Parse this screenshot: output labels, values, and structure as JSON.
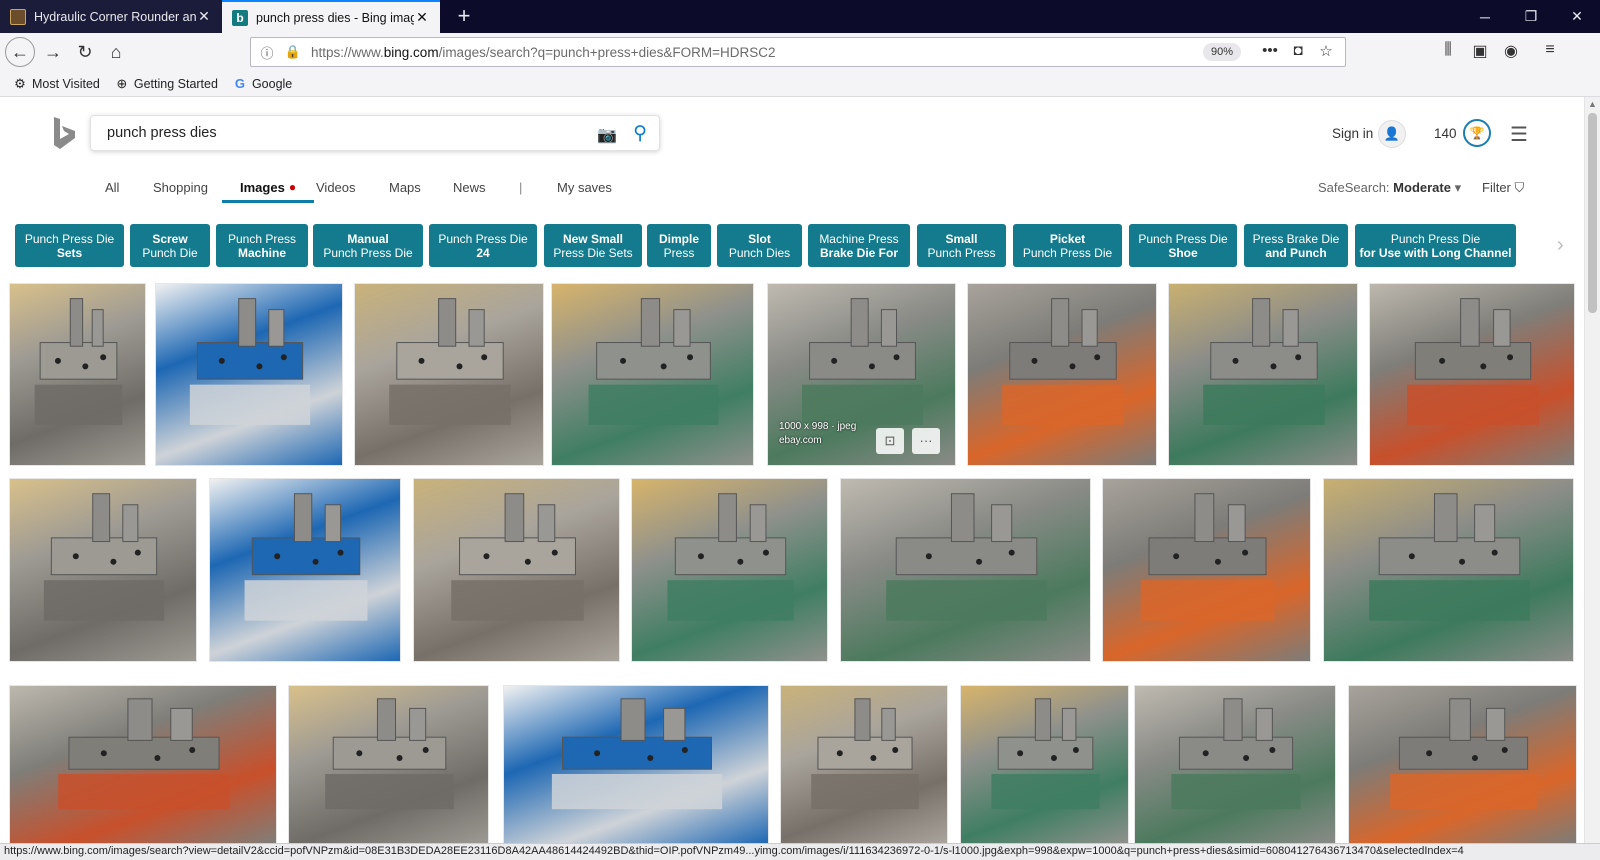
{
  "browser": {
    "tabs": [
      {
        "title": "Hydraulic Corner Rounder and",
        "active": false
      },
      {
        "title": "punch press dies - Bing images",
        "active": true
      }
    ],
    "url_prefix": "https://www.",
    "url_domain": "bing.com",
    "url_rest": "/images/search?q=punch+press+dies&FORM=HDRSC2",
    "zoom": "90%",
    "bookmarks": [
      "Most Visited",
      "Getting Started",
      "Google"
    ],
    "status_url": "https://www.bing.com/images/search?view=detailV2&ccid=pofVNPzm&id=08E31B3DEDA28EE23116D8A42AA48614424492BD&thid=OIP.pofVNPzm49...yimg.com/images/i/111634236972-0-1/s-l1000.jpg&exph=998&expw=1000&q=punch+press+dies&simid=608041276436713470&selectedIndex=4"
  },
  "search": {
    "query": "punch press dies"
  },
  "header": {
    "sign_in": "Sign in",
    "rewards_count": "140"
  },
  "scopes": {
    "all": "All",
    "shopping": "Shopping",
    "images": "Images",
    "videos": "Videos",
    "maps": "Maps",
    "news": "News",
    "sep": "|",
    "my_saves": "My saves",
    "safesearch_label": "SafeSearch:",
    "safesearch_value": "Moderate",
    "filter": "Filter"
  },
  "related": [
    {
      "line1": "Punch Press Die",
      "line2": "Sets",
      "bold_line": 2
    },
    {
      "line1": "Screw",
      "line2": "Punch Die",
      "bold_line": 1
    },
    {
      "line1": "Punch Press",
      "line2": "Machine",
      "bold_line": 2
    },
    {
      "line1": "Manual",
      "line2": "Punch Press Die",
      "bold_line": 1
    },
    {
      "line1": "Punch Press Die",
      "line2": "24",
      "bold_line": 2
    },
    {
      "line1": "New Small",
      "line2": "Press Die Sets",
      "bold_line": 1
    },
    {
      "line1": "Dimple",
      "line2": "Press",
      "bold_line": 1
    },
    {
      "line1": "Slot",
      "line2": "Punch Dies",
      "bold_line": 1
    },
    {
      "line1": "Machine Press",
      "line2": "Brake Die For",
      "bold_line": 2
    },
    {
      "line1": "Small",
      "line2": "Punch Press",
      "bold_line": 1
    },
    {
      "line1": "Picket",
      "line2": "Punch Press Die",
      "bold_line": 1
    },
    {
      "line1": "Punch Press Die",
      "line2": "Shoe",
      "bold_line": 2
    },
    {
      "line1": "Press Brake Die",
      "line2": "and Punch",
      "bold_line": 2
    },
    {
      "line1": "Punch Press Die",
      "line2": "for Use with Long Channel",
      "bold_line": 2
    }
  ],
  "hover_card": {
    "dims": "1000 x 998 · jpeg",
    "source": "ebay.com"
  },
  "colors": {
    "pill": "#147a8e",
    "accent": "#0a84ff",
    "bing_teal": "#137b80"
  }
}
